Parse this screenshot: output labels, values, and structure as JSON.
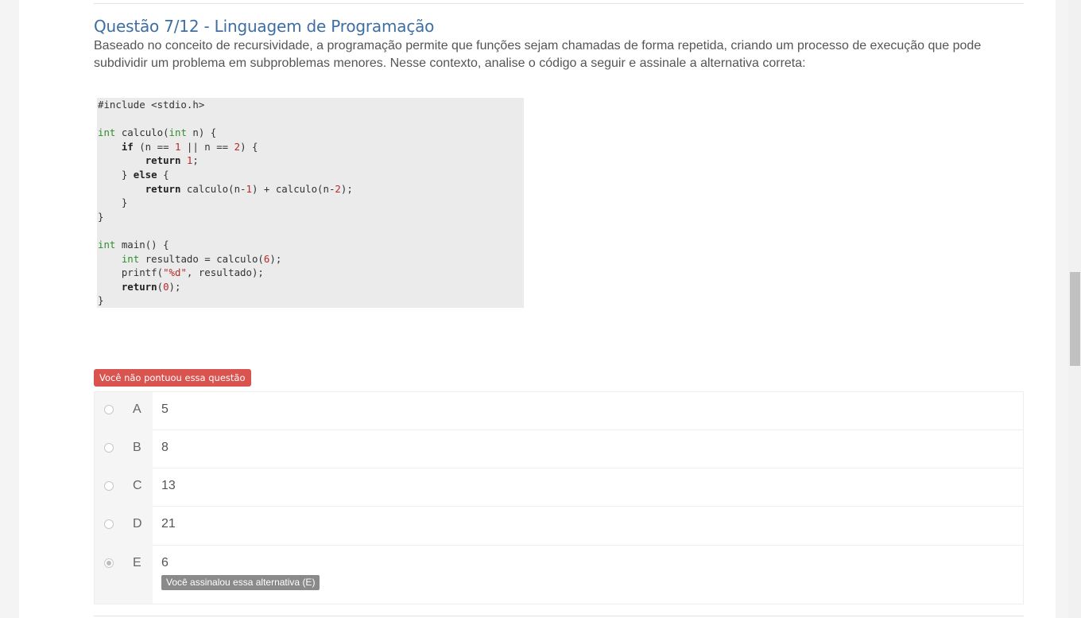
{
  "question": {
    "title": "Questão 7/12 - Linguagem de Programação",
    "text": "Baseado no conceito de recursividade, a programação permite que funções sejam chamadas de forma repetida, criando um processo de execução que pode subdividir um problema em subproblemas menores. Nesse contexto, analise o código a seguir e assinale a alternativa correta:"
  },
  "code": {
    "lines": [
      "#include <stdio.h>",
      "",
      "int calculo(int n) {",
      "    if (n == 1 || n == 2) {",
      "        return 1;",
      "    } else {",
      "        return calculo(n-1) + calculo(n-2);",
      "    }",
      "}",
      "",
      "int main() {",
      "    int resultado = calculo(6);",
      "    printf(\"%d\", resultado);",
      "    return(0);",
      "}"
    ]
  },
  "result_badge": "Você não pontuou essa questão",
  "options": [
    {
      "letter": "A",
      "text": "5",
      "checked": false
    },
    {
      "letter": "B",
      "text": "8",
      "checked": false
    },
    {
      "letter": "C",
      "text": "13",
      "checked": false
    },
    {
      "letter": "D",
      "text": "21",
      "checked": false
    },
    {
      "letter": "E",
      "text": "6",
      "checked": true,
      "note": "Você assinalou essa alternativa (E)"
    }
  ],
  "colors": {
    "title": "#3d6fa3",
    "badge_error": "#d9534f",
    "chosen_tag": "#8a8a8a"
  }
}
